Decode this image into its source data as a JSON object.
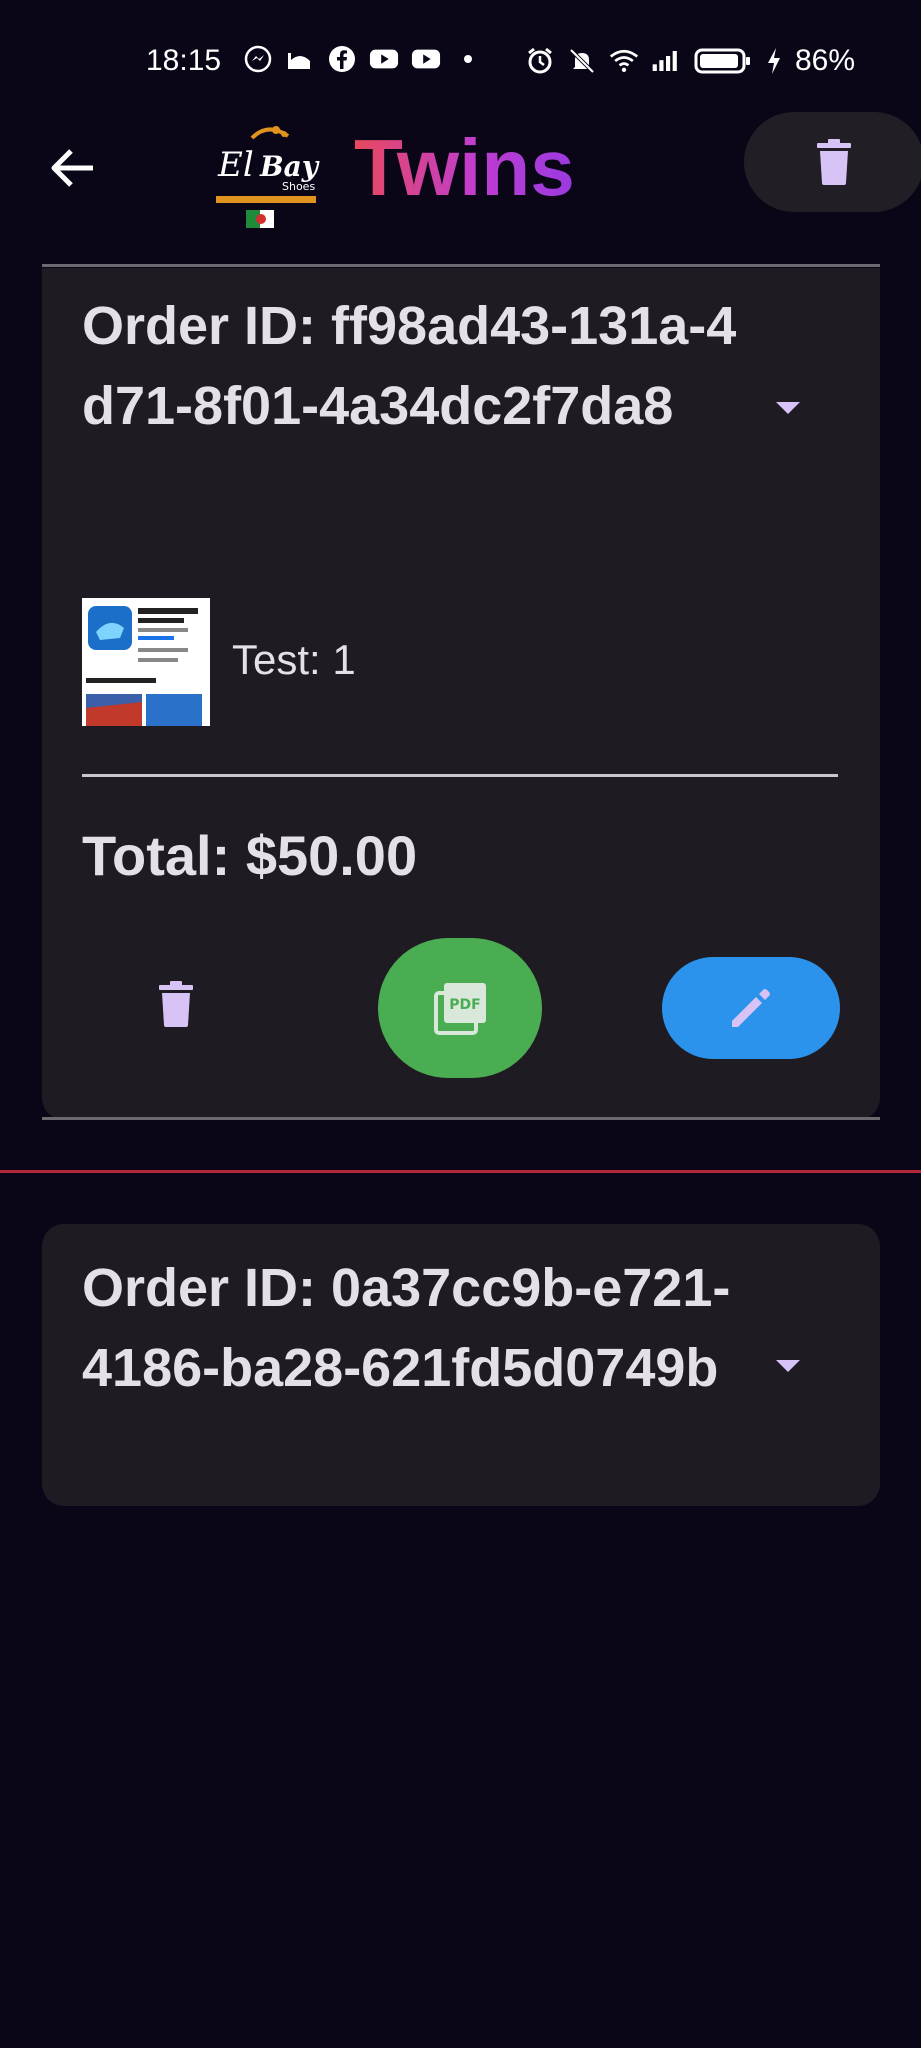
{
  "status_bar": {
    "time": "18:15",
    "battery": "86%",
    "icons": [
      "messenger-icon",
      "mosque-icon",
      "facebook-icon",
      "youtube-icon",
      "youtube-icon",
      "dot-icon",
      "alarm-icon",
      "mute-icon",
      "wifi-icon",
      "signal-icon",
      "battery-icon",
      "charging-icon"
    ]
  },
  "app_bar": {
    "title": "Twins",
    "logo_text": "El Bay Shoes",
    "title_gradient": [
      "#e8495c",
      "#c03dcf",
      "#9a3ae0"
    ]
  },
  "orders": [
    {
      "order_id_text": "Order ID: ff98ad43-131a-4d71-8f01-4a34dc2f7da8",
      "items": [
        {
          "label": "Test: 1"
        }
      ],
      "total": "Total: $50.00"
    },
    {
      "order_id_text": "Order ID: 0a37cc9b-e721-4186-ba28-621fd5d0749b"
    }
  ],
  "colors": {
    "background": "#0a0618",
    "card": "#1e1c22",
    "accent_icon": "#d7c3f6",
    "pdf_button": "#4bad52",
    "edit_button": "#2b93ec",
    "separator_red": "#b3273a"
  },
  "buttons": {
    "pdf_label": "PDF"
  }
}
